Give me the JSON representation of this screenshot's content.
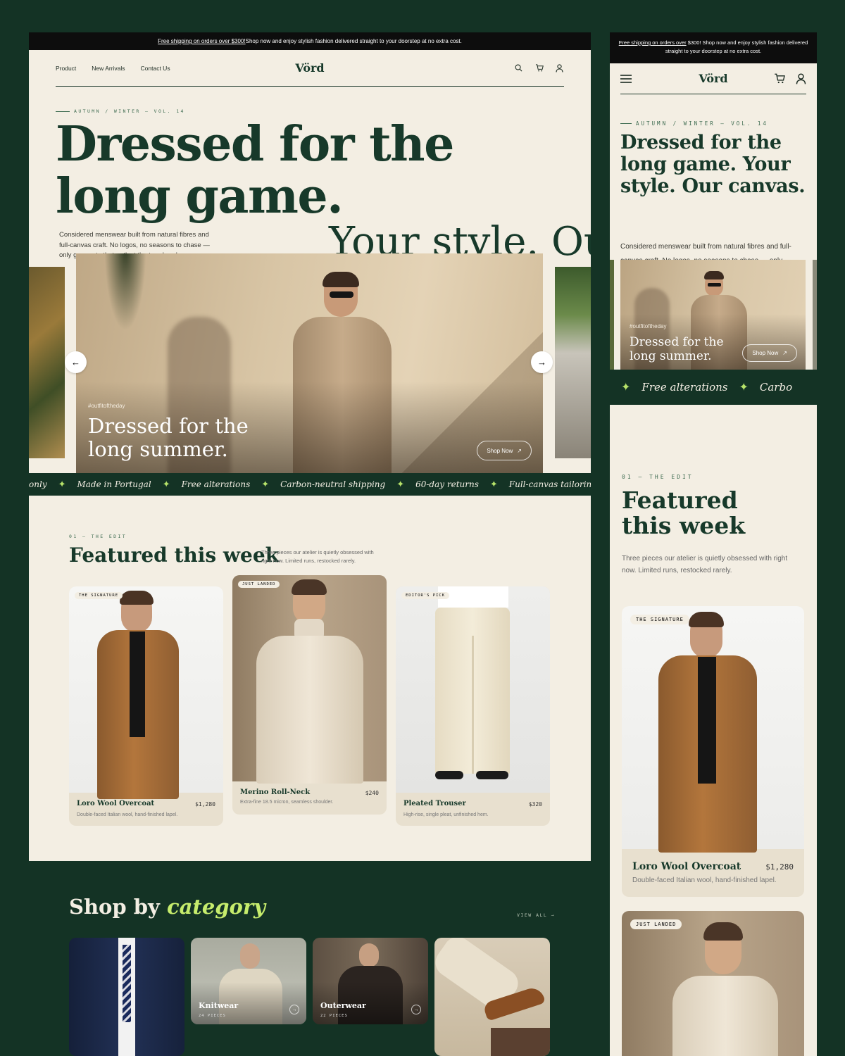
{
  "desktop": {
    "topbar": {
      "link": "Free shipping on orders over $300!",
      "rest": " Shop now and enjoy stylish fashion delivered straight to your doorstep at no extra cost."
    },
    "nav": {
      "links": [
        "Product",
        "New Arrivals",
        "Contact Us"
      ],
      "logo": "Vörd",
      "icons": [
        "search-icon",
        "cart-icon",
        "user-icon"
      ]
    },
    "hero": {
      "eyebrow": "AUTUMN / WINTER — VOL. 14",
      "title": "Dressed for the long game.",
      "title_b": "Your style. Our",
      "description": "Considered menswear built from natural fibres and full-canvas craft. No logos, no seasons to chase — only garments that outlast the trend cycle.",
      "slide": {
        "tag": "#outfitoftheday",
        "caption": "Dressed for the long summer.",
        "cta": "Shop Now"
      }
    },
    "marquee": [
      "only",
      "Made in Portugal",
      "Free alterations",
      "Carbon-neutral shipping",
      "60-day returns",
      "Full-canvas tailoring"
    ],
    "featured": {
      "eyebrow": "01 — THE EDIT",
      "title": "Featured this week",
      "description": "Three pieces our atelier is quietly obsessed with right now. Limited runs, restocked rarely.",
      "products": [
        {
          "badge": "THE SIGNATURE",
          "name": "Loro Wool Overcoat",
          "price": "$1,280",
          "desc": "Double-faced Italian wool, hand-finished lapel."
        },
        {
          "badge": "JUST LANDED",
          "name": "Merino Roll-Neck",
          "price": "$240",
          "desc": "Extra-fine 18.5 micron, seamless shoulder."
        },
        {
          "badge": "EDITOR'S PICK",
          "name": "Pleated Trouser",
          "price": "$320",
          "desc": "High-rise, single pleat, unfinished hem."
        }
      ]
    },
    "category": {
      "title_a": "Shop by ",
      "title_b": "category",
      "view_all": "VIEW ALL →",
      "items": [
        {
          "label": "",
          "count": ""
        },
        {
          "label": "Knitwear",
          "count": "24 PIECES"
        },
        {
          "label": "Outerwear",
          "count": "22 PIECES"
        },
        {
          "label": "",
          "count": ""
        }
      ]
    }
  },
  "mobile": {
    "topbar": {
      "link": "Free shipping on orders over",
      "rest": " $300! Shop now and enjoy stylish fashion delivered straight to your doorstep at no extra cost."
    },
    "logo": "Vörd",
    "hero": {
      "eyebrow": "AUTUMN / WINTER — VOL. 14",
      "title": "Dressed for the long game. Your style. Our canvas.",
      "description": "Considered menswear built from natural fibres and full-canvas craft. No logos, no seasons  to chase — only garments that outlast the trend cycle.",
      "slide": {
        "tag": "#outfitoftheday",
        "caption": "Dressed for the long summer.",
        "cta": "Shop Now"
      }
    },
    "marquee": [
      "Free alterations",
      "Carbo"
    ],
    "featured": {
      "eyebrow": "01 — THE EDIT",
      "title": "Featured this week",
      "description": "Three pieces our atelier is quietly obsessed with right now. Limited runs, restocked rarely.",
      "products": [
        {
          "badge": "THE SIGNATURE",
          "name": "Loro Wool Overcoat",
          "price": "$1,280",
          "desc": "Double-faced Italian wool, hand-finished lapel."
        },
        {
          "badge": "JUST LANDED"
        }
      ]
    }
  },
  "colors": {
    "forest": "#143325",
    "ink": "#17392a",
    "cream": "#f3eee3",
    "accent_lime": "#c6ec6c",
    "card": "#e8e0cf"
  }
}
